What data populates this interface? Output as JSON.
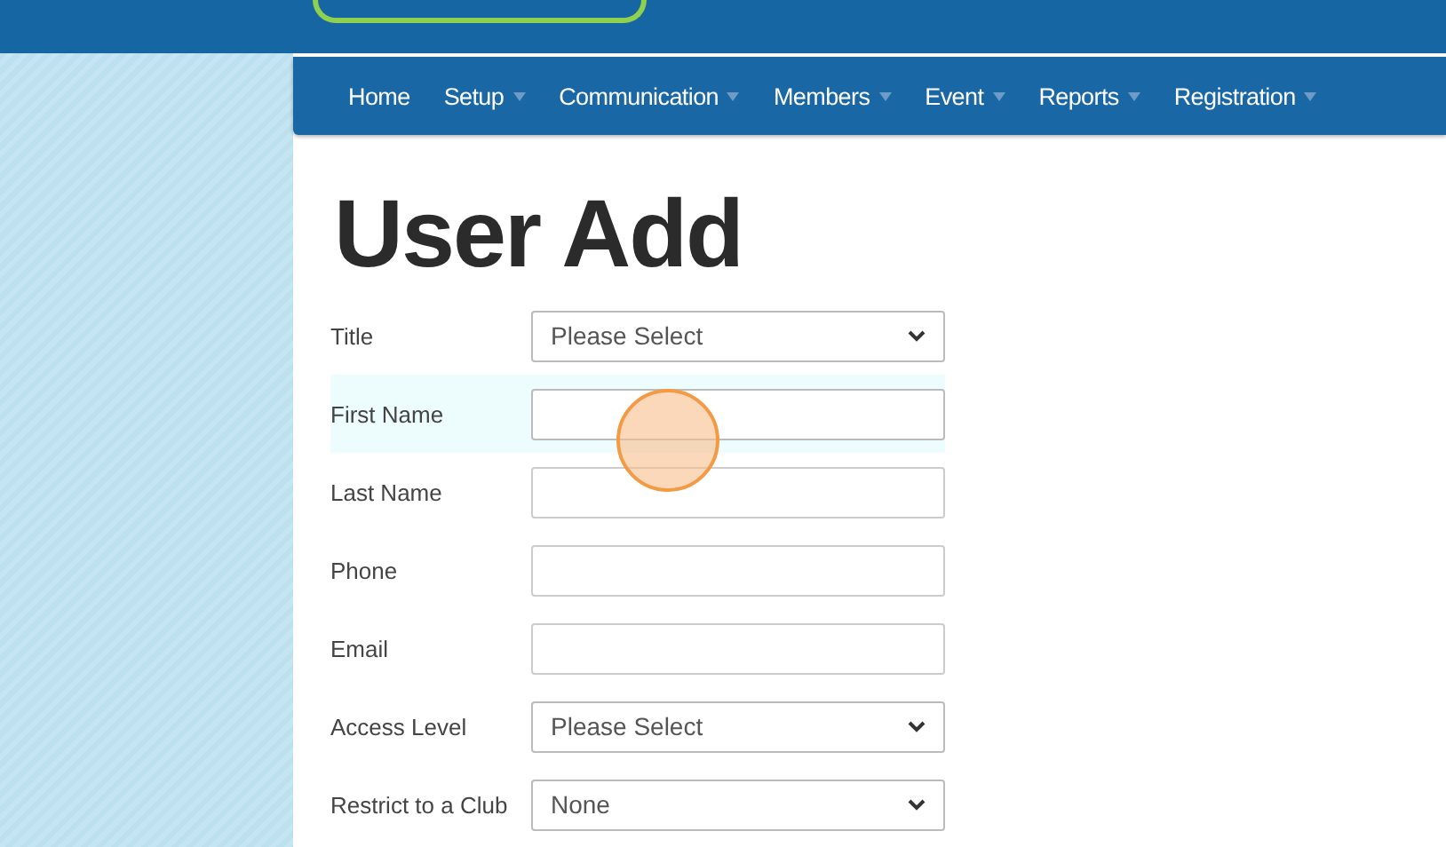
{
  "nav": [
    {
      "label": "Home",
      "has_menu": false
    },
    {
      "label": "Setup",
      "has_menu": true
    },
    {
      "label": "Communication",
      "has_menu": true
    },
    {
      "label": "Members",
      "has_menu": true
    },
    {
      "label": "Event",
      "has_menu": true
    },
    {
      "label": "Reports",
      "has_menu": true
    },
    {
      "label": "Registration",
      "has_menu": true
    }
  ],
  "heading": "User Add",
  "fields": [
    {
      "label": "Title",
      "kind": "select",
      "value": "Please Select",
      "focused": false
    },
    {
      "label": "First Name",
      "kind": "input",
      "focused": true
    },
    {
      "label": "Last Name",
      "kind": "input",
      "focused": false
    },
    {
      "label": "Phone",
      "kind": "input",
      "focused": false
    },
    {
      "label": "Email",
      "kind": "input",
      "focused": false
    },
    {
      "label": "Access Level",
      "kind": "select",
      "value": "Please Select",
      "focused": false
    },
    {
      "label": "Restrict to a Club",
      "kind": "select",
      "value": "None",
      "focused": false
    }
  ]
}
